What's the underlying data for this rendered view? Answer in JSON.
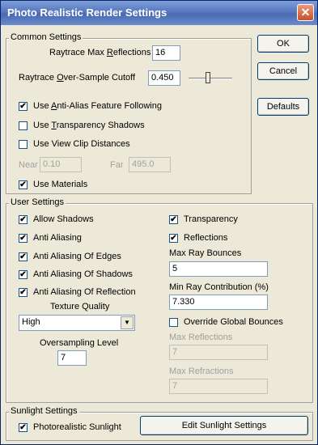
{
  "window": {
    "title": "Photo Realistic Render Settings"
  },
  "buttons": {
    "ok": "OK",
    "cancel": "Cancel",
    "defaults": "Defaults",
    "edit_sunlight": "Edit Sunlight Settings"
  },
  "common": {
    "label": "Common Settings",
    "raytrace_max_reflections": {
      "label_pre": "Raytrace Max ",
      "label_ul": "R",
      "label_post": "eflections",
      "value": "16"
    },
    "oversample_cutoff": {
      "label_pre": "Raytrace ",
      "label_ul": "O",
      "label_post": "ver-Sample Cutoff",
      "value": "0.450",
      "slider_fraction": 0.45
    },
    "anti_alias_following": {
      "label_pre": "Use ",
      "label_ul": "A",
      "label_post": "nti-Alias Feature Following",
      "checked": true
    },
    "transparency_shadows": {
      "label_pre": "Use ",
      "label_ul": "T",
      "label_post": "ransparency Shadows",
      "checked": false
    },
    "view_clip": {
      "label": "Use View Clip Distances",
      "checked": false
    },
    "near": {
      "label": "Near",
      "value": "0.10"
    },
    "far": {
      "label": "Far",
      "value": "495.0"
    },
    "use_materials": {
      "label": "Use Materials",
      "checked": true
    }
  },
  "user": {
    "label": "User Settings",
    "left_checks": [
      {
        "label": "Allow Shadows",
        "checked": true
      },
      {
        "label": "Anti Aliasing",
        "checked": true
      },
      {
        "label": "Anti Aliasing Of Edges",
        "checked": true
      },
      {
        "label": "Anti Aliasing Of Shadows",
        "checked": true
      },
      {
        "label": "Anti Aliasing Of Reflection",
        "checked": true
      }
    ],
    "texture_quality": {
      "label": "Texture Quality",
      "value": "High"
    },
    "oversampling_level": {
      "label": "Oversampling Level",
      "value": "7"
    },
    "transparency": {
      "label": "Transparency",
      "checked": true
    },
    "reflections": {
      "label": "Reflections",
      "checked": true
    },
    "max_ray_bounces": {
      "label": "Max Ray Bounces",
      "value": "5"
    },
    "min_ray_contribution": {
      "label": "Min Ray Contribution (%)",
      "value": "7.330"
    },
    "override_global": {
      "label": "Override Global Bounces",
      "checked": false
    },
    "max_reflections": {
      "label": "Max Reflections",
      "value": "7"
    },
    "max_refractions": {
      "label": "Max Refractions",
      "value": "7"
    }
  },
  "sunlight": {
    "label": "Sunlight Settings",
    "photorealistic": {
      "label": "Photorealistic Sunlight",
      "checked": true
    }
  }
}
